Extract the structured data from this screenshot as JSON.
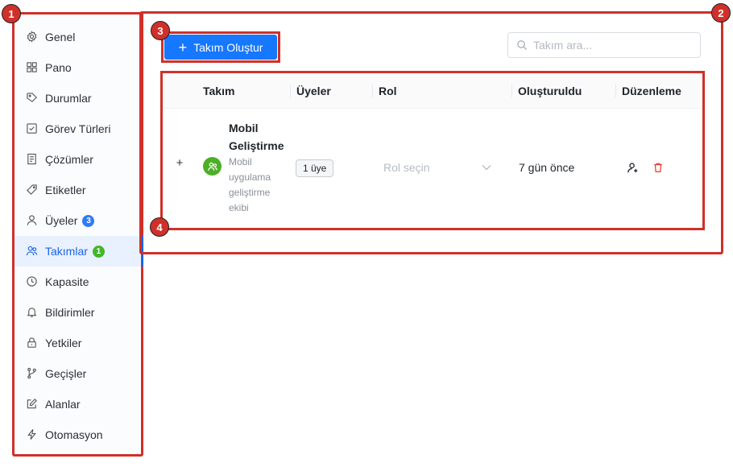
{
  "badges": [
    "1",
    "2",
    "3",
    "4"
  ],
  "sidebar": {
    "items": [
      {
        "label": "Genel",
        "icon": "gear-icon"
      },
      {
        "label": "Pano",
        "icon": "grid-icon"
      },
      {
        "label": "Durumlar",
        "icon": "tag-icon"
      },
      {
        "label": "Görev Türleri",
        "icon": "checkbox-icon"
      },
      {
        "label": "Çözümler",
        "icon": "document-icon"
      },
      {
        "label": "Etiketler",
        "icon": "label-icon"
      },
      {
        "label": "Üyeler",
        "icon": "user-icon",
        "count": "3"
      },
      {
        "label": "Takımlar",
        "icon": "team-icon",
        "count": "1",
        "active": true
      },
      {
        "label": "Kapasite",
        "icon": "clock-icon"
      },
      {
        "label": "Bildirimler",
        "icon": "bell-icon"
      },
      {
        "label": "Yetkiler",
        "icon": "lock-icon"
      },
      {
        "label": "Geçişler",
        "icon": "branch-icon"
      },
      {
        "label": "Alanlar",
        "icon": "edit-icon"
      },
      {
        "label": "Otomasyon",
        "icon": "bolt-icon"
      }
    ]
  },
  "toolbar": {
    "create_label": "Takım Oluştur",
    "search_placeholder": "Takım ara..."
  },
  "table": {
    "headers": [
      "Takım",
      "Üyeler",
      "Rol",
      "Oluşturuldu",
      "Düzenleme"
    ],
    "rows": [
      {
        "expand": "+",
        "name": "Mobil Geliştirme",
        "description": "Mobil uygulama geliştirme ekibi",
        "members": "1 üye",
        "role_placeholder": "Rol seçin",
        "created": "7 gün önce"
      }
    ]
  },
  "colors": {
    "accent": "#1677ff",
    "highlight": "#d0302a",
    "team_icon": "#4caf26",
    "danger": "#e5372b"
  }
}
